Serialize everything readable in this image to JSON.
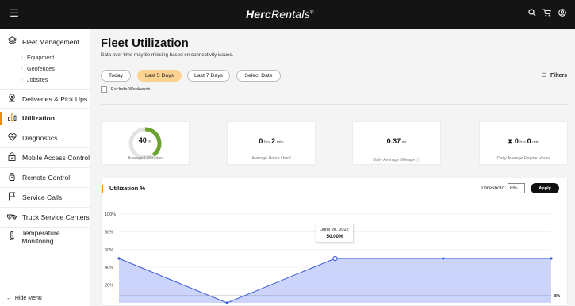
{
  "topbar": {
    "brand_bold": "Herc",
    "brand_rest": "Rentals",
    "menu_icon": "hamburger-icon",
    "icons": [
      "search-icon",
      "cart-icon",
      "account-icon"
    ]
  },
  "sidebar": {
    "fleet_management": {
      "label": "Fleet Management",
      "icon": "layers-icon",
      "sub_items": [
        "Equipment",
        "Geofences",
        "Jobsites"
      ]
    },
    "items": [
      {
        "label": "Deliveries & Pick Ups",
        "icon": "map-pin-icon"
      },
      {
        "label": "Utilization",
        "icon": "bar-chart-icon",
        "active": true
      },
      {
        "label": "Diagnostics",
        "icon": "pulse-icon"
      },
      {
        "label": "Mobile Access Control",
        "icon": "lock-icon"
      },
      {
        "label": "Remote Control",
        "icon": "remote-icon"
      },
      {
        "label": "Service Calls",
        "icon": "flag-icon"
      },
      {
        "label": "Truck Service Centers",
        "icon": "truck-icon"
      },
      {
        "label": "Temperature Monitoring",
        "icon": "thermometer-icon"
      }
    ],
    "hide_menu": "Hide Menu"
  },
  "main": {
    "title": "Fleet Utilization",
    "subtitle": "Data over time may be missing based on connectivity issues.",
    "date_filters": [
      {
        "label": "Today",
        "active": false
      },
      {
        "label": "Last 5 Days",
        "active": true
      },
      {
        "label": "Last 7 Days",
        "active": false
      },
      {
        "label": "Select Date",
        "active": false
      }
    ],
    "filters_label": "Filters",
    "exclude_weekends": "Exclude Weekends",
    "cards": [
      {
        "value": "40",
        "unit": "%",
        "label": "Average Utilization",
        "progress": 0.4
      },
      {
        "value_a": "0",
        "unit_a": "hrs",
        "value_b": "2",
        "unit_b": "min",
        "label": "Average Hours Used"
      },
      {
        "value": "0.37",
        "unit": "mi",
        "label": "Daily Average Mileage"
      },
      {
        "value_a": "0",
        "unit_a": "hrs",
        "value_b": "0",
        "unit_b": "min",
        "label": "Daily Average Engine Hours"
      }
    ],
    "chart_panel": {
      "title": "Utilization %",
      "threshold_label": "Threshold:",
      "threshold_value": "8%",
      "apply_label": "Apply",
      "tooltip_date": "June 20, 2022",
      "tooltip_value": "50.00%",
      "threshold_line_label": "8%"
    }
  },
  "colors": {
    "accent": "#f08a00",
    "active_pill": "#fbd28f",
    "gauge": "#6aa42f",
    "line": "#3b5bdb",
    "area": "#c9d2fb"
  },
  "chart_data": {
    "type": "area",
    "y_ticks": [
      "100%",
      "80%",
      "60%",
      "40%",
      "20%"
    ],
    "ylim": [
      0,
      100
    ],
    "values": [
      50,
      0,
      50,
      50,
      50
    ],
    "threshold": 8,
    "highlight_index": 2
  }
}
